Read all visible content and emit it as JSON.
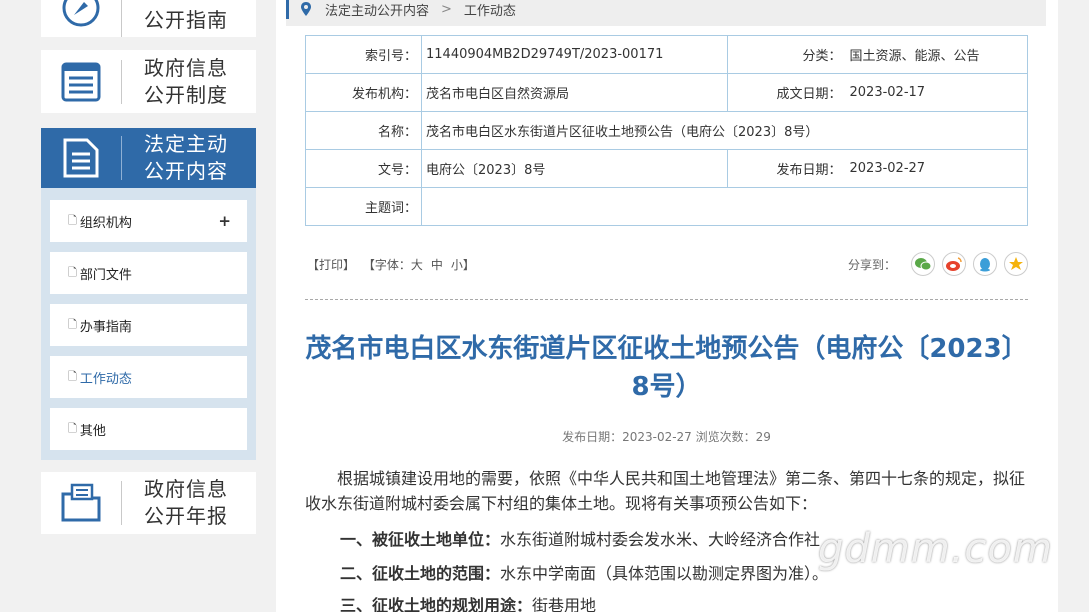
{
  "sidebar": {
    "blocks": [
      {
        "line1": "",
        "line2": "公开指南"
      },
      {
        "line1": "政府信息",
        "line2": "公开制度"
      },
      {
        "line1": "法定主动",
        "line2": "公开内容"
      },
      {
        "line1": "政府信息",
        "line2": "公开年报"
      }
    ],
    "submenu": [
      {
        "label": "组织机构",
        "icon": "doc-icon"
      },
      {
        "label": "部门文件",
        "icon": "doc-icon"
      },
      {
        "label": "办事指南",
        "icon": "doc-icon"
      },
      {
        "label": "工作动态",
        "icon": "doc-icon"
      },
      {
        "label": "其他",
        "icon": "doc-icon"
      }
    ],
    "expand_symbol": "+"
  },
  "breadcrumb": {
    "items": [
      "法定主动公开内容",
      "工作动态"
    ],
    "separator": ">"
  },
  "meta": {
    "index_label": "索引号：",
    "index_value": "11440904MB2D29749T/2023-00171",
    "category_label": "分类：",
    "category_value": "国土资源、能源、公告",
    "publisher_label": "发布机构：",
    "publisher_value": "茂名市电白区自然资源局",
    "created_label": "成文日期：",
    "created_value": "2023-02-17",
    "name_label": "名称：",
    "name_value": "茂名市电白区水东街道片区征收土地预公告（电府公〔2023〕8号）",
    "docno_label": "文号：",
    "docno_value": "电府公〔2023〕8号",
    "pubdate_label": "发布日期：",
    "pubdate_value": "2023-02-27",
    "subject_label": "主题词：",
    "subject_value": ""
  },
  "tools": {
    "print": "【打印】",
    "font_prefix": "【字体：",
    "font_large": "大",
    "font_medium": "中",
    "font_small": "小",
    "font_suffix": "】",
    "share_label": "分享到：",
    "share_icons": [
      "wechat-icon",
      "weibo-icon",
      "qq-icon",
      "qzone-icon"
    ],
    "colors": {
      "wechat": "#5aa848",
      "weibo": "#e6422c",
      "qq": "#3b9ed8",
      "qzone": "#f5b30c"
    }
  },
  "article": {
    "title": "茂名市电白区水东街道片区征收土地预公告（电府公〔2023〕8号）",
    "pubinfo": "发布日期：2023-02-27  浏览次数：29",
    "para1": "根据城镇建设用地的需要，依照《中华人民共和国土地管理法》第二条、第四十七条的规定，拟征收水东街道附城村委会属下村组的集体土地。现将有关事项预公告如下：",
    "item1_head": "一、被征收土地单位：",
    "item1_text": "水东街道附城村委会发水米、大岭经济合作社",
    "item2_head": "二、征收土地的范围：",
    "item2_text": "水东中学南面（具体范围以勘测定界图为准）。",
    "item3_head": "三、征收土地的规划用途：",
    "item3_text": "街巷用地"
  },
  "watermark": "gdmm.com",
  "colors": {
    "accent": "#2f6aa8",
    "table_border": "#a9cbe3",
    "submenu_bg": "#d6e3ee"
  }
}
